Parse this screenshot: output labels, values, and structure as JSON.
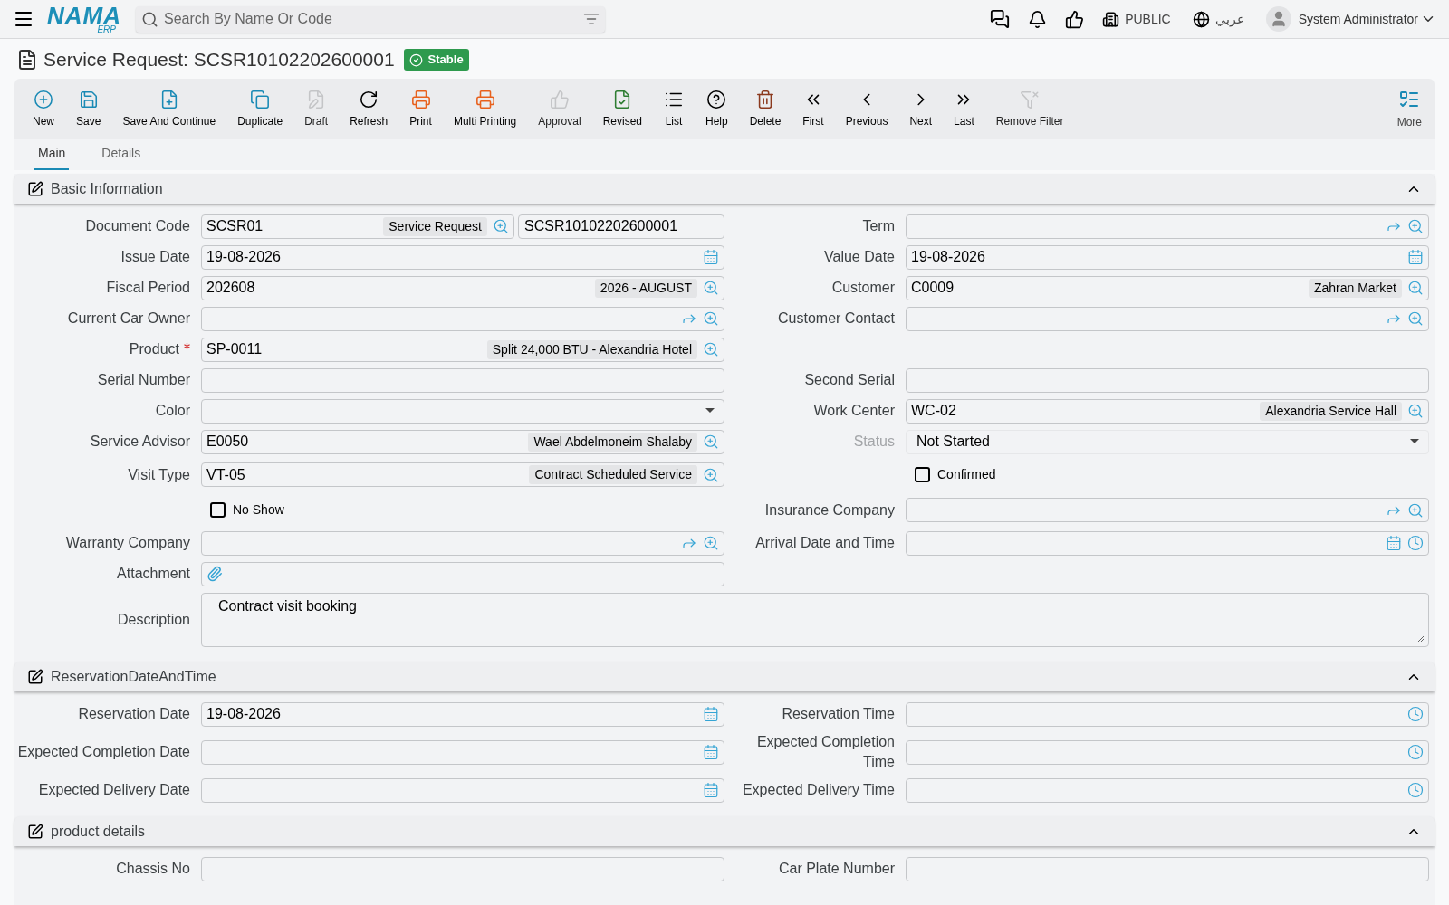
{
  "header": {
    "logo": "NAMA",
    "logo_sub": "ERP",
    "search": {
      "placeholder": "Search By Name Or Code"
    },
    "branch": "PUBLIC",
    "language": "عربي",
    "user": "System Administrator"
  },
  "title": {
    "text": "Service Request: SCSR10102202600001",
    "badge": "Stable"
  },
  "toolbar": [
    {
      "kind": "new",
      "label": "New",
      "disabled": false
    },
    {
      "kind": "save",
      "label": "Save",
      "disabled": false
    },
    {
      "kind": "save-continue",
      "label": "Save And Continue",
      "disabled": false
    },
    {
      "kind": "duplicate",
      "label": "Duplicate",
      "disabled": false
    },
    {
      "kind": "draft",
      "label": "Draft",
      "disabled": true
    },
    {
      "kind": "refresh",
      "label": "Refresh",
      "disabled": false
    },
    {
      "kind": "print",
      "label": "Print",
      "disabled": false
    },
    {
      "kind": "multi-print",
      "label": "Multi Printing",
      "disabled": false
    },
    {
      "kind": "approval",
      "label": "Approval",
      "disabled": true
    },
    {
      "kind": "revised",
      "label": "Revised",
      "disabled": false
    },
    {
      "kind": "list",
      "label": "List",
      "disabled": false
    },
    {
      "kind": "help",
      "label": "Help",
      "disabled": false
    },
    {
      "kind": "delete",
      "label": "Delete",
      "disabled": false
    },
    {
      "kind": "first",
      "label": "First",
      "disabled": false
    },
    {
      "kind": "previous",
      "label": "Previous",
      "disabled": false
    },
    {
      "kind": "next",
      "label": "Next",
      "disabled": false
    },
    {
      "kind": "last",
      "label": "Last",
      "disabled": false
    },
    {
      "kind": "remove-filter",
      "label": "Remove Filter",
      "disabled": true
    }
  ],
  "more": "More",
  "tabs": [
    {
      "label": "Main",
      "selected": true
    },
    {
      "label": "Details",
      "selected": false
    }
  ],
  "sections": [
    {
      "title": "Basic Information",
      "expanded": true,
      "rows": [
        {
          "cells": [
            {
              "kind": "field",
              "label": "Document Code",
              "value": "SCSR01",
              "tag": "Service Request",
              "buttons": [
                {
                  "kind": "lookup"
                }
              ],
              "extra": "SCSR10102202600001"
            },
            {
              "kind": "field",
              "label": "Term",
              "buttons": [
                {
                  "kind": "share"
                },
                {
                  "kind": "lookup"
                }
              ]
            }
          ]
        },
        {
          "cells": [
            {
              "kind": "field",
              "label": "Issue Date",
              "value": "19-08-2026",
              "buttons": [
                {
                  "kind": "calendar"
                }
              ]
            },
            {
              "kind": "field",
              "label": "Value Date",
              "value": "19-08-2026",
              "buttons": [
                {
                  "kind": "calendar"
                }
              ]
            }
          ]
        },
        {
          "cells": [
            {
              "kind": "field",
              "label": "Fiscal Period",
              "value": "202608",
              "tag": "2026 - AUGUST",
              "buttons": [
                {
                  "kind": "lookup"
                }
              ]
            },
            {
              "kind": "field",
              "label": "Customer",
              "value": "C0009",
              "tag": "Zahran Market",
              "buttons": [
                {
                  "kind": "lookup"
                }
              ]
            }
          ]
        },
        {
          "cells": [
            {
              "kind": "field",
              "label": "Current Car Owner",
              "buttons": [
                {
                  "kind": "share"
                },
                {
                  "kind": "lookup"
                }
              ]
            },
            {
              "kind": "field",
              "label": "Customer Contact",
              "buttons": [
                {
                  "kind": "share"
                },
                {
                  "kind": "lookup"
                }
              ]
            }
          ]
        },
        {
          "cells": [
            {
              "kind": "field",
              "label": "Product",
              "required": true,
              "value": "SP-0011",
              "tag": "Split 24,000 BTU - Alexandria Hotel",
              "buttons": [
                {
                  "kind": "lookup"
                }
              ]
            },
            {
              "kind": "empty"
            }
          ]
        },
        {
          "cells": [
            {
              "kind": "field",
              "label": "Serial Number"
            },
            {
              "kind": "field",
              "label": "Second Serial"
            }
          ]
        },
        {
          "cells": [
            {
              "kind": "field",
              "label": "Color",
              "buttons": [
                {
                  "kind": "dropdown"
                }
              ]
            },
            {
              "kind": "field",
              "label": "Work Center",
              "value": "WC-02",
              "tag": "Alexandria Service Hall",
              "buttons": [
                {
                  "kind": "lookup"
                }
              ]
            }
          ]
        },
        {
          "cells": [
            {
              "kind": "field",
              "label": "Service Advisor",
              "value": "E0050",
              "tag": "Wael Abdelmoneim Shalaby",
              "buttons": [
                {
                  "kind": "lookup"
                }
              ]
            },
            {
              "kind": "field",
              "label": "Status",
              "value": "Not Started",
              "disabled": true,
              "buttons": [
                {
                  "kind": "dropdown"
                }
              ]
            }
          ]
        },
        {
          "cells": [
            {
              "kind": "field",
              "label": "Visit Type",
              "value": "VT-05",
              "tag": "Contract Scheduled Service",
              "buttons": [
                {
                  "kind": "lookup"
                }
              ]
            },
            {
              "kind": "checkbox",
              "label": "Confirmed",
              "checked": false
            }
          ]
        },
        {
          "cells": [
            {
              "kind": "checkbox",
              "label": "No Show",
              "checked": false
            },
            {
              "kind": "field",
              "label": "Insurance Company",
              "buttons": [
                {
                  "kind": "share"
                },
                {
                  "kind": "lookup"
                }
              ]
            }
          ]
        },
        {
          "cells": [
            {
              "kind": "field",
              "label": "Warranty Company",
              "buttons": [
                {
                  "kind": "share"
                },
                {
                  "kind": "lookup"
                }
              ]
            },
            {
              "kind": "field",
              "label": "Arrival Date and Time",
              "buttons": [
                {
                  "kind": "calendar"
                },
                {
                  "kind": "clock"
                }
              ]
            }
          ]
        },
        {
          "cells": [
            {
              "kind": "field",
              "label": "Attachment",
              "buttons": [
                {
                  "kind": "attach"
                }
              ]
            },
            {
              "kind": "empty"
            }
          ]
        },
        {
          "cells": [
            {
              "kind": "textarea",
              "label": "Description",
              "value": "Contract visit booking"
            }
          ]
        }
      ]
    },
    {
      "title": "ReservationDateAndTime",
      "expanded": true,
      "rows": [
        {
          "cells": [
            {
              "kind": "field",
              "label": "Reservation Date",
              "value": "19-08-2026",
              "buttons": [
                {
                  "kind": "calendar"
                }
              ]
            },
            {
              "kind": "field",
              "label": "Reservation Time",
              "buttons": [
                {
                  "kind": "clock"
                }
              ]
            }
          ]
        },
        {
          "cells": [
            {
              "kind": "field",
              "label": "Expected Completion Date",
              "buttons": [
                {
                  "kind": "calendar"
                }
              ]
            },
            {
              "kind": "field",
              "label": "Expected Completion Time",
              "buttons": [
                {
                  "kind": "clock"
                }
              ]
            }
          ]
        },
        {
          "cells": [
            {
              "kind": "field",
              "label": "Expected Delivery Date",
              "buttons": [
                {
                  "kind": "calendar"
                }
              ]
            },
            {
              "kind": "field",
              "label": "Expected Delivery Time",
              "buttons": [
                {
                  "kind": "clock"
                }
              ]
            }
          ]
        }
      ]
    },
    {
      "title": "product details",
      "expanded": true,
      "rows": [
        {
          "cells": [
            {
              "kind": "field",
              "label": "Chassis No"
            },
            {
              "kind": "field",
              "label": "Car Plate Number"
            }
          ]
        }
      ]
    }
  ]
}
